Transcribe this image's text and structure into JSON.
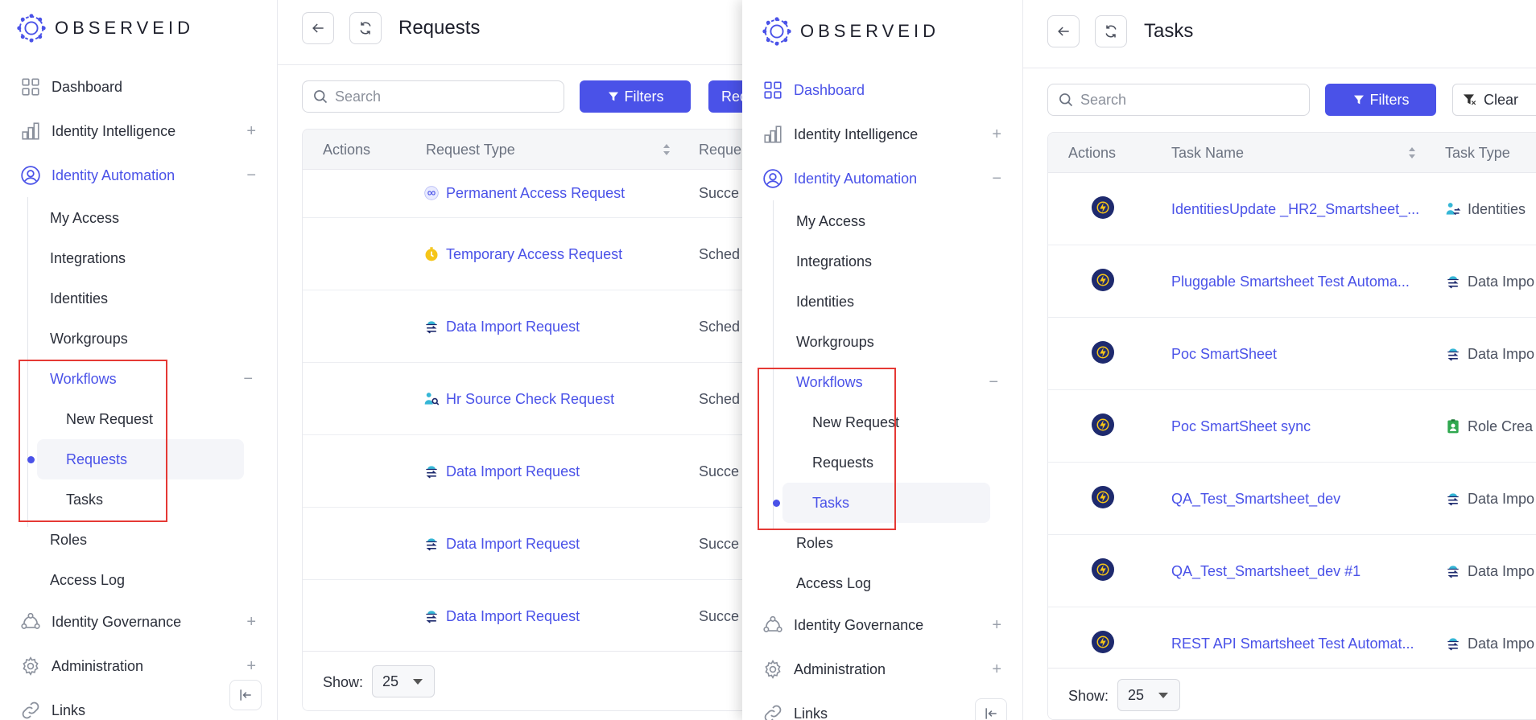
{
  "brand": {
    "name": "OBSERVEID",
    "accent": "#4a52e8",
    "highlight": "#e53935"
  },
  "left_panel": {
    "sidebar": {
      "dashboard": "Dashboard",
      "identity_intelligence": "Identity Intelligence",
      "identity_automation": "Identity Automation",
      "my_access": "My Access",
      "integrations": "Integrations",
      "identities": "Identities",
      "workgroups": "Workgroups",
      "workflows": "Workflows",
      "new_request": "New Request",
      "requests": "Requests",
      "tasks": "Tasks",
      "roles": "Roles",
      "access_log": "Access Log",
      "identity_governance": "Identity Governance",
      "administration": "Administration",
      "links": "Links",
      "plus": "+",
      "minus": "−"
    },
    "header": {
      "title": "Requests"
    },
    "toolbar": {
      "search_placeholder": "Search",
      "filters_label": "Filters",
      "extra_label": "Req"
    },
    "table": {
      "columns": [
        "Actions",
        "Request Type",
        "Reque"
      ],
      "rows": [
        {
          "type": "Permanent Access Request",
          "icon": "infinity-icon",
          "status": "Succe"
        },
        {
          "type": "Temporary Access Request",
          "icon": "timer-icon",
          "status": "Sched"
        },
        {
          "type": "Data Import Request",
          "icon": "data-import-icon",
          "status": "Sched"
        },
        {
          "type": "Hr Source Check Request",
          "icon": "hr-source-icon",
          "status": "Sched"
        },
        {
          "type": "Data Import Request",
          "icon": "data-import-icon",
          "status": "Succe"
        },
        {
          "type": "Data Import Request",
          "icon": "data-import-icon",
          "status": "Succe"
        },
        {
          "type": "Data Import Request",
          "icon": "data-import-icon",
          "status": "Succe"
        }
      ]
    },
    "footer": {
      "show_label": "Show:",
      "page_size": "25"
    }
  },
  "right_panel": {
    "sidebar": {
      "dashboard": "Dashboard",
      "identity_intelligence": "Identity Intelligence",
      "identity_automation": "Identity Automation",
      "my_access": "My Access",
      "integrations": "Integrations",
      "identities": "Identities",
      "workgroups": "Workgroups",
      "workflows": "Workflows",
      "new_request": "New Request",
      "requests": "Requests",
      "tasks": "Tasks",
      "roles": "Roles",
      "access_log": "Access Log",
      "identity_governance": "Identity Governance",
      "administration": "Administration",
      "links": "Links",
      "plus": "+",
      "minus": "−"
    },
    "header": {
      "title": "Tasks"
    },
    "toolbar": {
      "search_placeholder": "Search",
      "filters_label": "Filters",
      "clear_label": "Clear"
    },
    "table": {
      "columns": [
        "Actions",
        "Task Name",
        "Task Type"
      ],
      "rows": [
        {
          "name": "IdentitiesUpdate _HR2_Smartsheet_...",
          "type": "Identities",
          "type_icon": "identities-icon"
        },
        {
          "name": "Pluggable Smartsheet Test Automa...",
          "type": "Data Impo",
          "type_icon": "data-import-icon"
        },
        {
          "name": "Poc SmartSheet",
          "type": "Data Impo",
          "type_icon": "data-import-icon"
        },
        {
          "name": "Poc SmartSheet sync",
          "type": "Role Crea",
          "type_icon": "role-badge-icon"
        },
        {
          "name": "QA_Test_Smartsheet_dev",
          "type": "Data Impo",
          "type_icon": "data-import-icon"
        },
        {
          "name": "QA_Test_Smartsheet_dev #1",
          "type": "Data Impo",
          "type_icon": "data-import-icon"
        },
        {
          "name": "REST API Smartsheet Test Automat...",
          "type": "Data Impo",
          "type_icon": "data-import-icon"
        }
      ]
    },
    "footer": {
      "show_label": "Show:",
      "page_size": "25"
    }
  }
}
